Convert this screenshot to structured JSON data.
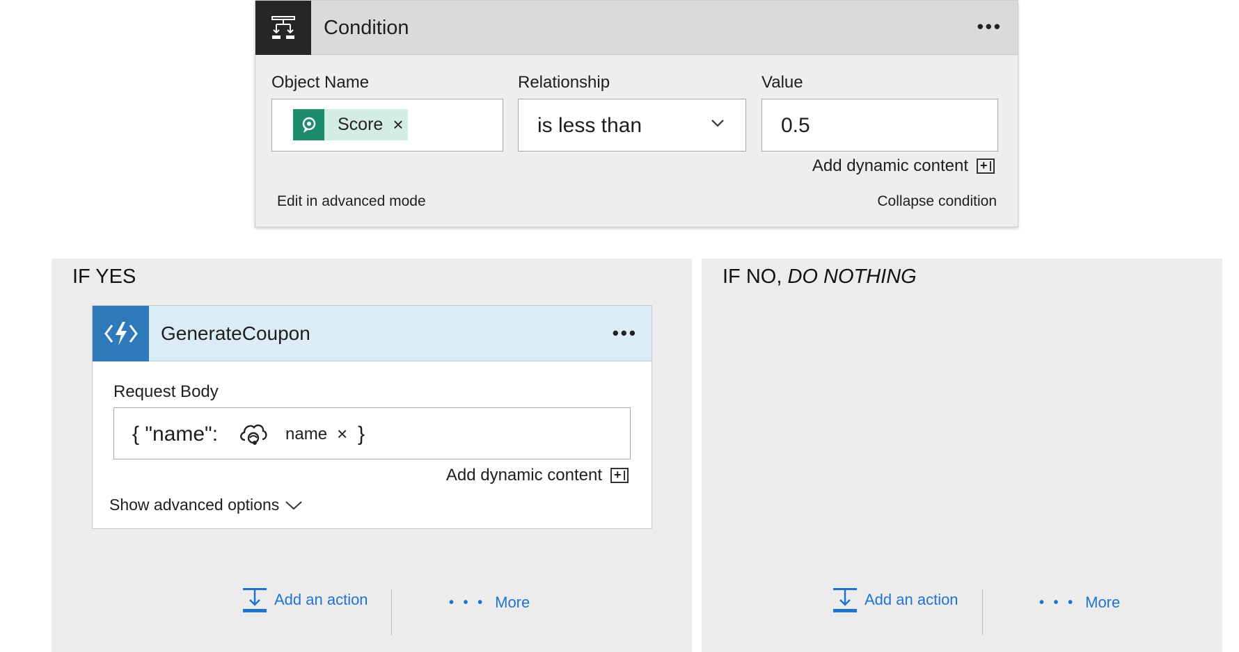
{
  "condition": {
    "title": "Condition",
    "menu_icon": "ellipsis-icon",
    "fields": {
      "object_name_label": "Object Name",
      "relationship_label": "Relationship",
      "value_label": "Value",
      "object_token": "Score",
      "object_token_remove": "×",
      "relationship_value": "is less than",
      "value": "0.5"
    },
    "add_dynamic_content": "Add dynamic content",
    "edit_advanced": "Edit in advanced mode",
    "collapse": "Collapse condition"
  },
  "branch_yes": {
    "title": "IF YES",
    "action_card": {
      "title": "GenerateCoupon",
      "request_body_label": "Request Body",
      "body_prefix": "{ \"name\":",
      "body_token": "name",
      "body_token_remove": "×",
      "body_suffix": "}",
      "add_dynamic_content": "Add dynamic content",
      "show_advanced": "Show advanced options"
    },
    "add_action": "Add an action",
    "more": "More",
    "more_dots": "• • •"
  },
  "branch_no": {
    "title_prefix": "IF NO,",
    "title_emphasis": "DO NOTHING",
    "add_action": "Add an action",
    "more": "More",
    "more_dots": "• • •"
  },
  "colors": {
    "accent_link": "#1f73d1",
    "condition_icon_bg": "#262626",
    "function_icon_bg": "#2e79b9",
    "score_token_bg": "#d3ece5",
    "score_icon_bg": "#1c8c6b"
  }
}
